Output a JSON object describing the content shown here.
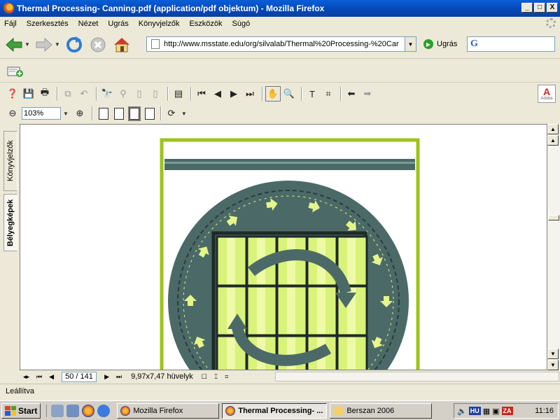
{
  "window": {
    "title": "Thermal Processing- Canning.pdf (application/pdf objektum) - Mozilla Firefox",
    "minimize": "_",
    "maximize": "□",
    "close": "X"
  },
  "menu": [
    "Fájl",
    "Szerkesztés",
    "Nézet",
    "Ugrás",
    "Könyvjelzők",
    "Eszközök",
    "Súgó"
  ],
  "nav": {
    "url": "http://www.msstate.edu/org/silvalab/Thermal%20Processing-%20Car",
    "go_label": "Ugrás",
    "search_logo": "G"
  },
  "pdf": {
    "zoom": "103%",
    "page_display": "50 / 141",
    "page_size": "9,97x7,47 hüvelyk",
    "side_tabs": [
      "Könyvjelzők",
      "Bélyegképek"
    ],
    "adobe_label": "Adobe"
  },
  "status": {
    "text": "Leállítva"
  },
  "taskbar": {
    "start": "Start",
    "tasks": [
      {
        "label": "Mozilla Firefox",
        "active": false
      },
      {
        "label": "Thermal Processing- ...",
        "active": true
      },
      {
        "label": "Berszan 2006",
        "active": false
      }
    ],
    "lang": "HU",
    "za": "ZA",
    "clock": "11:16"
  },
  "colors": {
    "titlebar": "#0548b8",
    "frame": "#9dc41a",
    "retort": "#4b6a67",
    "jar": "#d9f27a",
    "arrow": "#e6f58a"
  }
}
